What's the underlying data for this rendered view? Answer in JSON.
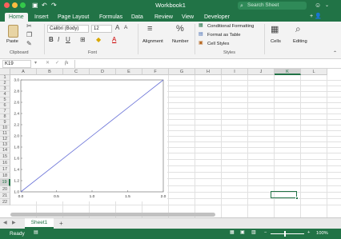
{
  "window": {
    "title": "Workbook1",
    "search_placeholder": "Search Sheet",
    "traffic_colors": [
      "#fc605c",
      "#fdbc40",
      "#34c84a"
    ]
  },
  "ribbon_tabs": [
    {
      "label": "Home",
      "active": true
    },
    {
      "label": "Insert",
      "active": false
    },
    {
      "label": "Page Layout",
      "active": false
    },
    {
      "label": "Formulas",
      "active": false
    },
    {
      "label": "Data",
      "active": false
    },
    {
      "label": "Review",
      "active": false
    },
    {
      "label": "View",
      "active": false
    },
    {
      "label": "Developer",
      "active": false
    }
  ],
  "share_label": "+",
  "ribbon": {
    "paste_label": "Paste",
    "clipboard_label": "Clipboard",
    "font_name": "Calibri (Body)",
    "font_size": "12",
    "grow_font": "A",
    "shrink_font": "A",
    "bold": "B",
    "italic": "I",
    "underline": "U",
    "font_color_glyph": "A",
    "font_group_label": "Font",
    "alignment_label": "Alignment",
    "number_label": "Number",
    "number_glyph": "%",
    "conditional_formatting": "Conditional Formatting",
    "format_as_table": "Format as Table",
    "cell_styles": "Cell Styles",
    "styles_label": "Styles",
    "cells_label": "Cells",
    "editing_label": "Editing"
  },
  "formula_bar": {
    "name_box": "K19",
    "fx": "fx",
    "cancel": "✕",
    "confirm": "✓",
    "value": ""
  },
  "columns": [
    "A",
    "B",
    "C",
    "D",
    "E",
    "F",
    "G",
    "H",
    "I",
    "J",
    "K",
    "L"
  ],
  "selected_column": "K",
  "rows": [
    "1",
    "2",
    "3",
    "4",
    "5",
    "6",
    "7",
    "8",
    "9",
    "10",
    "11",
    "12",
    "13",
    "14",
    "15",
    "16",
    "17",
    "18",
    "19",
    "20",
    "21",
    "22"
  ],
  "selected_row": "19",
  "sheet_tabs": [
    {
      "label": "Sheet1",
      "active": true
    }
  ],
  "add_sheet": "+",
  "status": {
    "ready": "Ready",
    "zoom_minus": "−",
    "zoom_plus": "+",
    "zoom": "100%"
  },
  "colors": {
    "excel_green": "#217346",
    "line_color": "#6b74d8",
    "grid_line": "#e1e1e1"
  },
  "chart_data": {
    "type": "line",
    "series": [
      {
        "x": [
          0.0,
          2.0
        ],
        "y": [
          1.0,
          3.0
        ]
      }
    ],
    "xlim": [
      0.0,
      2.0
    ],
    "ylim": [
      1.0,
      3.0
    ],
    "xticks": [
      "0.0",
      "0.5",
      "1.0",
      "1.5",
      "2.0"
    ],
    "yticks": [
      "1.0",
      "1.2",
      "1.4",
      "1.6",
      "1.8",
      "2.0",
      "2.2",
      "2.4",
      "2.6",
      "2.8",
      "3.0"
    ],
    "grid": false,
    "title": "",
    "xlabel": "",
    "ylabel": ""
  }
}
